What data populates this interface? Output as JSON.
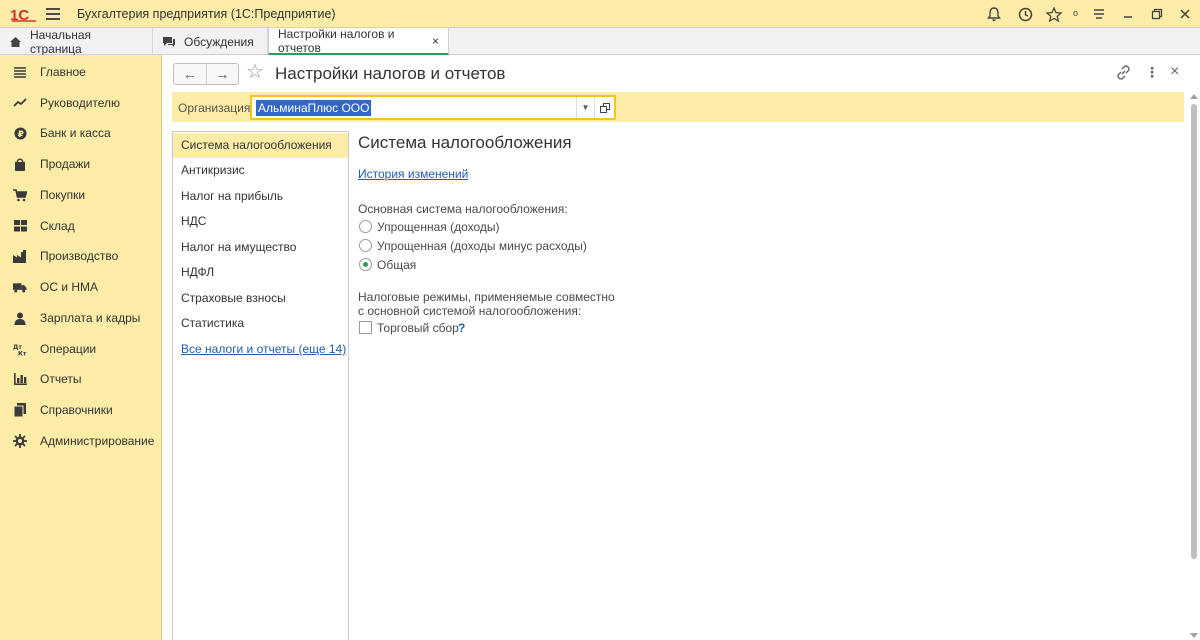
{
  "titlebar": {
    "logo": "1С",
    "app_title": "Бухгалтерия предприятия  (1С:Предприятие)",
    "icons": [
      "bell-icon",
      "history-icon",
      "star-icon",
      "settings-icon",
      "minimize-icon",
      "restore-icon",
      "close-icon"
    ],
    "small_label": "о"
  },
  "tabs": [
    {
      "label": "Начальная страница",
      "icon": "home-icon",
      "active": false
    },
    {
      "label": "Обсуждения",
      "icon": "chat-icon",
      "active": false
    },
    {
      "label": "Настройки налогов и отчетов",
      "icon": "",
      "active": true,
      "close": "×"
    }
  ],
  "sidebar": {
    "items": [
      {
        "label": "Главное",
        "icon": "menu-icon"
      },
      {
        "label": "Руководителю",
        "icon": "trend-icon"
      },
      {
        "label": "Банк и касса",
        "icon": "ruble-icon"
      },
      {
        "label": "Продажи",
        "icon": "bag-icon"
      },
      {
        "label": "Покупки",
        "icon": "cart-icon"
      },
      {
        "label": "Склад",
        "icon": "warehouse-icon"
      },
      {
        "label": "Производство",
        "icon": "factory-icon"
      },
      {
        "label": "ОС и НМА",
        "icon": "truck-icon"
      },
      {
        "label": "Зарплата и кадры",
        "icon": "person-icon"
      },
      {
        "label": "Операции",
        "icon": "dt-kt-icon"
      },
      {
        "label": "Отчеты",
        "icon": "bar-chart-icon"
      },
      {
        "label": "Справочники",
        "icon": "books-icon"
      },
      {
        "label": "Администрирование",
        "icon": "gear-icon"
      }
    ]
  },
  "header": {
    "back": "←",
    "forward": "→",
    "star": "☆",
    "title": "Настройки налогов и отчетов",
    "link_icon": "link-icon",
    "more": "⋮",
    "close": "×"
  },
  "org": {
    "label": "Организация:",
    "value": "АльминаПлюс ООО"
  },
  "leftnav": {
    "items": [
      {
        "label": "Система налогообложения",
        "active": true,
        "link": false
      },
      {
        "label": "Антикризис",
        "active": false,
        "link": false
      },
      {
        "label": "Налог на прибыль",
        "active": false,
        "link": false
      },
      {
        "label": "НДС",
        "active": false,
        "link": false
      },
      {
        "label": "Налог на имущество",
        "active": false,
        "link": false
      },
      {
        "label": "НДФЛ",
        "active": false,
        "link": false
      },
      {
        "label": "Страховые взносы",
        "active": false,
        "link": false
      },
      {
        "label": "Статистика",
        "active": false,
        "link": false
      },
      {
        "label": "Все налоги и отчеты (еще 14)",
        "active": false,
        "link": true
      }
    ]
  },
  "content": {
    "title": "Система налогообложения",
    "history_link": "История изменений",
    "main_system_label": "Основная система налогообложения:",
    "options": [
      {
        "label": "Упрощенная (доходы)",
        "selected": false
      },
      {
        "label": "Упрощенная (доходы минус расходы)",
        "selected": false
      },
      {
        "label": "Общая",
        "selected": true
      }
    ],
    "combined_label_line1": "Налоговые режимы, применяемые совместно",
    "combined_label_line2": "с основной системой налогообложения:",
    "trade_fee": {
      "label": "Торговый сбор",
      "checked": false,
      "help": "?"
    }
  },
  "colors": {
    "accent_yellow": "#fbeda8",
    "active_green": "#2e9a5d",
    "link_blue": "#1e5fa8",
    "selection_blue": "#3367c8",
    "focus_yellow": "#f5c518"
  }
}
